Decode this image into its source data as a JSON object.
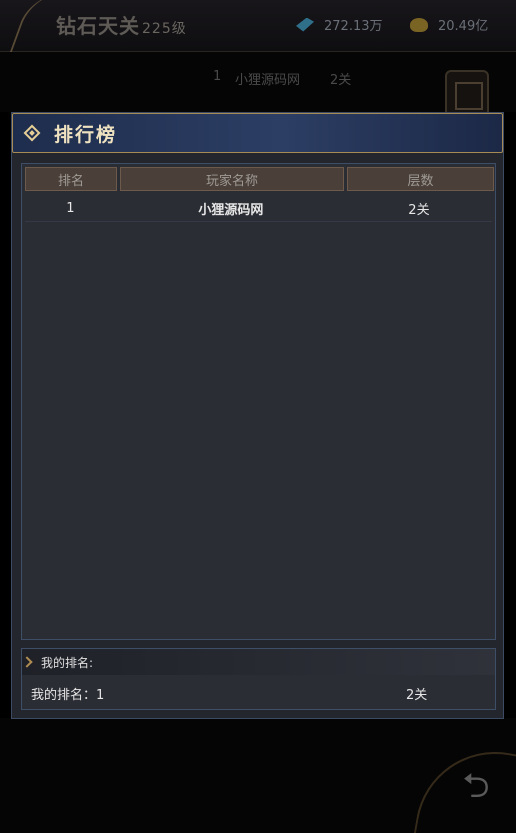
{
  "background": {
    "title": "钻石天关",
    "level": "225级",
    "resources": [
      {
        "icon": "gem-icon",
        "value": "272.13万"
      },
      {
        "icon": "gold-ingot-icon",
        "value": "20.49亿"
      }
    ],
    "rank_row": {
      "rank": "1",
      "name": "小狸源码网",
      "floor": "2关"
    }
  },
  "panel": {
    "title": "排行榜",
    "columns": [
      "排名",
      "玩家名称",
      "层数"
    ],
    "rows": [
      {
        "rank": "1",
        "name": "小狸源码网",
        "floor": "2关"
      }
    ],
    "my_rank_header": "我的排名:",
    "my_rank_text": "我的排名：1",
    "my_floor": "2关"
  },
  "colors": {
    "header_gradient": "#2c3e64",
    "gold_border": "#a78b55",
    "panel_bg": "#24262d"
  }
}
